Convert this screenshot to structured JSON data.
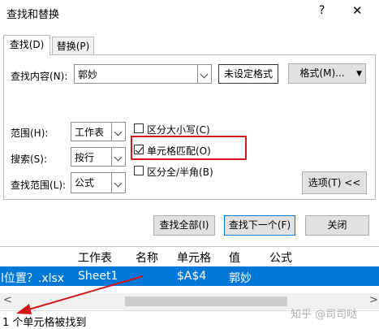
{
  "dialog": {
    "title": "查找和替换",
    "help": "?",
    "close": "✕"
  },
  "tabs": [
    {
      "label": "查找(D)"
    },
    {
      "label": "替换(P)"
    }
  ],
  "find": {
    "label": "查找内容(N):",
    "value": "郭妙",
    "format_status": "未设定格式",
    "format_button": "格式(M)..."
  },
  "options": {
    "scope_label": "范围(H):",
    "scope_value": "工作表",
    "search_label": "搜索(S):",
    "search_value": "按行",
    "lookin_label": "查找范围(L):",
    "lookin_value": "公式",
    "match_case": {
      "label": "区分大小写(C)",
      "checked": false
    },
    "match_cell": {
      "label": "单元格匹配(O)",
      "checked": true
    },
    "match_width": {
      "label": "区分全/半角(B)",
      "checked": false
    },
    "options_button": "选项(T) <<"
  },
  "actions": {
    "find_all": "查找全部(I)",
    "find_next": "查找下一个(F)",
    "close": "关闭"
  },
  "results": {
    "columns": [
      "工作表",
      "名称",
      "单元格",
      "值",
      "公式"
    ],
    "rows": [
      {
        "book": "l位置？.xlsx",
        "sheet": "Sheet1",
        "name": "",
        "cell": "$A$4",
        "value": "郭妙",
        "formula": ""
      }
    ]
  },
  "scroll": {
    "left": "<",
    "right": ">"
  },
  "status": "1 个单元格被找到",
  "watermark": "知乎 @司司哒",
  "colors": {
    "highlight_box": "#d4161a",
    "selected_row": "#0078d7",
    "arrow": "#d4161a"
  }
}
